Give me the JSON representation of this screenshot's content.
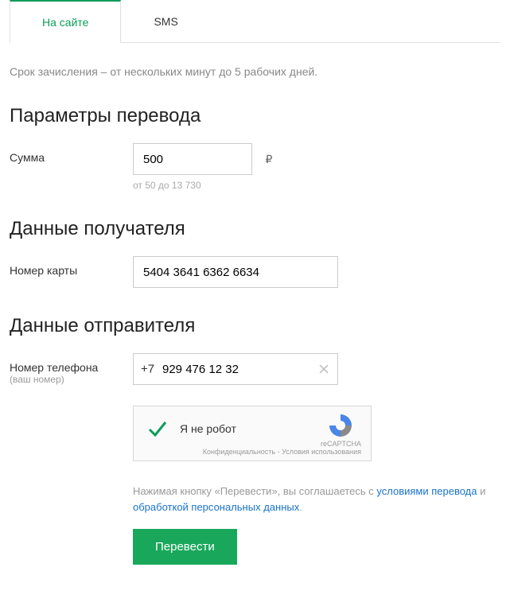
{
  "tabs": {
    "onsite": "На сайте",
    "sms": "SMS"
  },
  "hint": "Срок зачисления – от нескольких минут до 5 рабочих дней.",
  "sections": {
    "params": "Параметры перевода",
    "recipient": "Данные получателя",
    "sender": "Данные отправителя"
  },
  "amount": {
    "label": "Сумма",
    "value": "500",
    "currency": "₽",
    "range": "от 50 до 13 730"
  },
  "card": {
    "label": "Номер карты",
    "value": "5404 3641 6362 6634"
  },
  "phone": {
    "label": "Номер телефона",
    "sublabel": "(ваш номер)",
    "prefix": "+7",
    "value": "929 476 12 32"
  },
  "captcha": {
    "text": "Я не робот",
    "brand": "reCAPTCHA",
    "footer": "Конфиденциальность - Условия использования"
  },
  "legal": {
    "part1": "Нажимая кнопку «Перевести», вы соглашаетесь с ",
    "link1": "условиями перевода",
    "part2": " и ",
    "link2": "обработкой персональных данных",
    "part3": "."
  },
  "submit": "Перевести"
}
